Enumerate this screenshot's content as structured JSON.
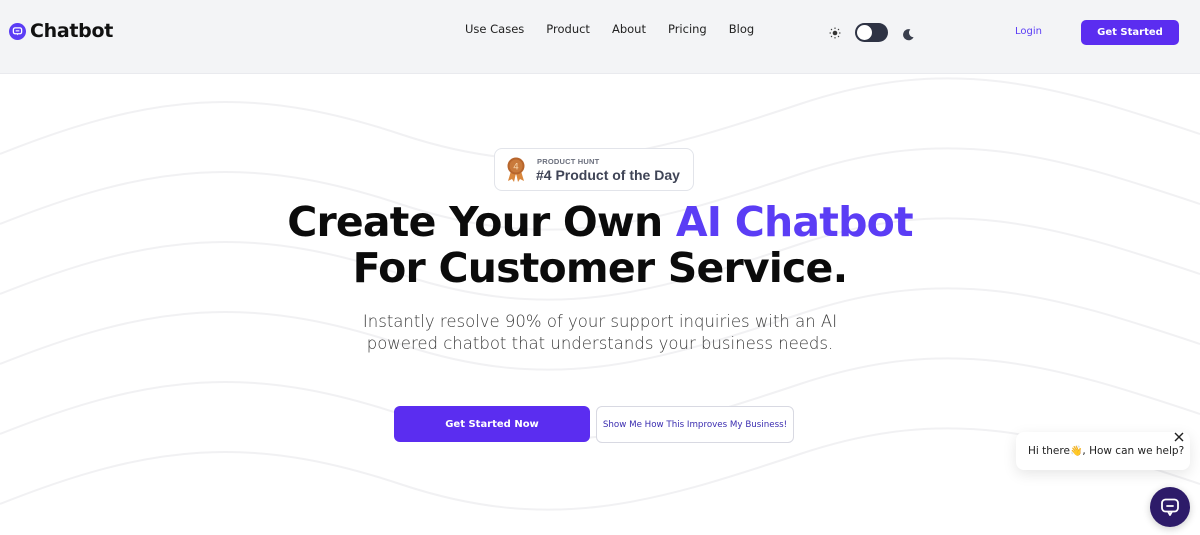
{
  "header": {
    "logo_text": "Chatbot",
    "nav": [
      "Use Cases",
      "Product",
      "About",
      "Pricing",
      "Blog"
    ],
    "theme_toggle": {
      "mode": "light"
    },
    "login_label": "Login",
    "get_started_label": "Get Started"
  },
  "badge": {
    "rank": "4",
    "source": "PRODUCT HUNT",
    "title": "#4 Product of the Day"
  },
  "hero": {
    "headline_line1_prefix": "Create Your Own ",
    "headline_line1_accent": "AI Chatbot",
    "headline_line2": "For Customer Service.",
    "subheadline": "Instantly resolve 90% of your support inquiries with an AI powered chatbot that understands your business needs.",
    "primary_cta": "Get Started Now",
    "secondary_cta": "Show Me How This Improves My Business!"
  },
  "chat_widget": {
    "greeting_prefix": "Hi there ",
    "greeting_emoji": "👋",
    "greeting_suffix": ", How can we help?"
  },
  "colors": {
    "accent": "#5b3df5",
    "button": "#5b2df0",
    "launcher": "#2d1b69",
    "header_bg": "#f3f4f6"
  }
}
